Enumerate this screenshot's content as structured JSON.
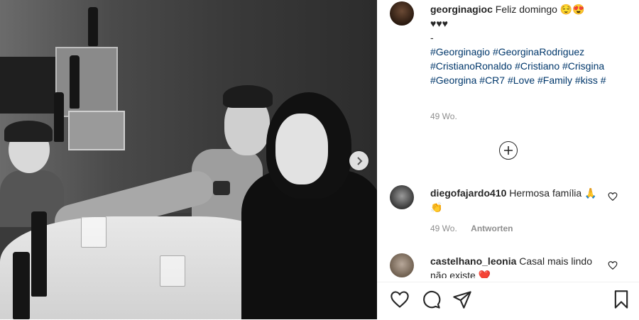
{
  "post": {
    "username": "georginagioc",
    "caption": "Feliz domingo 😌😍",
    "hearts_line": "♥♥♥",
    "dash": "-",
    "hashtags": [
      "#Georginagio",
      "#GeorginaRodriguez",
      "#CristianoRonaldo",
      "#Cristiano",
      "#Crisgina",
      "#Georgina",
      "#CR7",
      "#Love",
      "#Family",
      "#kiss",
      "#"
    ],
    "age": "49 Wo."
  },
  "comments": [
    {
      "username": "diegofajardo410",
      "text": "Hermosa família 🙏👏",
      "age": "49 Wo.",
      "reply_label": "Antworten"
    },
    {
      "username": "castelhano_leonia",
      "text": "Casal mais lindo não existe ❤️"
    }
  ],
  "icons": {
    "load_more": "plus-circle-icon",
    "like": "heart-icon",
    "comment": "comment-bubble-icon",
    "share": "paper-plane-icon",
    "save": "bookmark-icon",
    "next": "chevron-right-icon"
  },
  "colors": {
    "link": "#00376b",
    "muted": "#8e8e8e",
    "text": "#262626"
  }
}
